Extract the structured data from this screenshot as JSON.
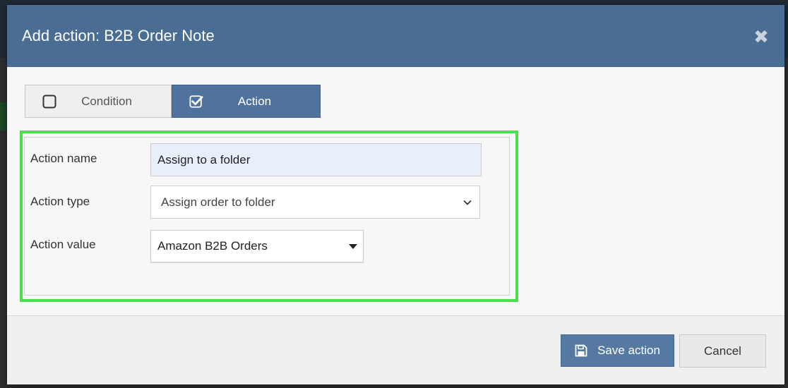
{
  "modal": {
    "title": "Add action: B2B Order Note",
    "close_icon": "close-icon"
  },
  "tabs": [
    {
      "label": "Condition",
      "checked": false,
      "active": false
    },
    {
      "label": "Action",
      "checked": true,
      "active": true
    }
  ],
  "form": {
    "action_name": {
      "label": "Action name",
      "value": "Assign to a folder"
    },
    "action_type": {
      "label": "Action type",
      "selected": "Assign order to folder"
    },
    "action_value": {
      "label": "Action value",
      "selected": "Amazon B2B Orders"
    }
  },
  "footer": {
    "save_label": "Save action",
    "cancel_label": "Cancel"
  },
  "colors": {
    "header": "#4a6d93",
    "active_tab": "#4f739c",
    "save_button": "#5579a0",
    "highlight": "#4be04b",
    "input_fill": "#e8effb"
  }
}
